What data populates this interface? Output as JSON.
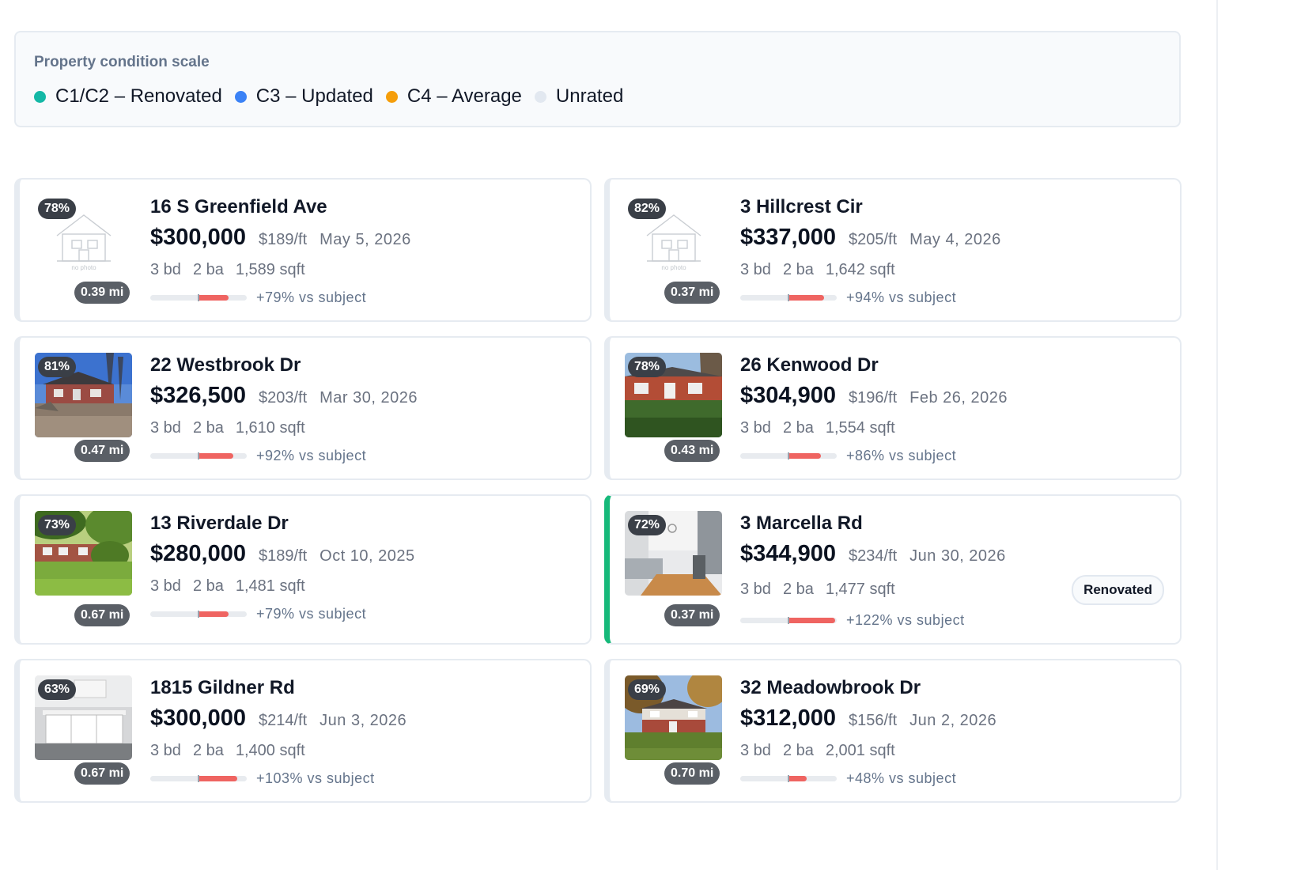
{
  "legend": {
    "title": "Property condition scale",
    "items": [
      {
        "label": "C1/C2 – Renovated",
        "color": "#14b8a6"
      },
      {
        "label": "C3 – Updated",
        "color": "#3b82f6"
      },
      {
        "label": "C4 – Average",
        "color": "#f59e0b"
      },
      {
        "label": "Unrated",
        "color": "#e2e8f0"
      }
    ]
  },
  "comps": [
    {
      "address": "16 S Greenfield Ave",
      "price": "$300,000",
      "ppsf": "$189/ft",
      "date": "May 5, 2026",
      "beds": "3 bd",
      "baths": "2 ba",
      "sqft": "1,589 sqft",
      "vs": "+79% vs subject",
      "vs_pct": 79,
      "score": "78%",
      "distance": "0.39 mi",
      "photo": "no-photo-icon",
      "no_photo_label": "no photo"
    },
    {
      "address": "3 Hillcrest Cir",
      "price": "$337,000",
      "ppsf": "$205/ft",
      "date": "May 4, 2026",
      "beds": "3 bd",
      "baths": "2 ba",
      "sqft": "1,642 sqft",
      "vs": "+94% vs subject",
      "vs_pct": 94,
      "score": "82%",
      "distance": "0.37 mi",
      "photo": "no-photo-icon",
      "no_photo_label": "no photo"
    },
    {
      "address": "22 Westbrook Dr",
      "price": "$326,500",
      "ppsf": "$203/ft",
      "date": "Mar 30, 2026",
      "beds": "3 bd",
      "baths": "2 ba",
      "sqft": "1,610 sqft",
      "vs": "+92% vs subject",
      "vs_pct": 92,
      "score": "81%",
      "distance": "0.47 mi",
      "photo": "house-exterior-winter"
    },
    {
      "address": "26 Kenwood Dr",
      "price": "$304,900",
      "ppsf": "$196/ft",
      "date": "Feb 26, 2026",
      "beds": "3 bd",
      "baths": "2 ba",
      "sqft": "1,554 sqft",
      "vs": "+86% vs subject",
      "vs_pct": 86,
      "score": "78%",
      "distance": "0.43 mi",
      "photo": "house-exterior-lawn"
    },
    {
      "address": "13 Riverdale Dr",
      "price": "$280,000",
      "ppsf": "$189/ft",
      "date": "Oct 10, 2025",
      "beds": "3 bd",
      "baths": "2 ba",
      "sqft": "1,481 sqft",
      "vs": "+79% vs subject",
      "vs_pct": 79,
      "score": "73%",
      "distance": "0.67 mi",
      "photo": "house-exterior-trees"
    },
    {
      "address": "3 Marcella Rd",
      "price": "$344,900",
      "ppsf": "$234/ft",
      "date": "Jun 30, 2026",
      "beds": "3 bd",
      "baths": "2 ba",
      "sqft": "1,477 sqft",
      "vs": "+122% vs subject",
      "vs_pct": 122,
      "score": "72%",
      "distance": "0.37 mi",
      "photo": "kitchen-interior",
      "badge": "Renovated",
      "condition_color": "#16b97a"
    },
    {
      "address": "1815 Gildner Rd",
      "price": "$300,000",
      "ppsf": "$214/ft",
      "date": "Jun 3, 2026",
      "beds": "3 bd",
      "baths": "2 ba",
      "sqft": "1,400 sqft",
      "vs": "+103% vs subject",
      "vs_pct": 103,
      "score": "63%",
      "distance": "0.67 mi",
      "photo": "kitchen-island-interior"
    },
    {
      "address": "32 Meadowbrook Dr",
      "price": "$312,000",
      "ppsf": "$156/ft",
      "date": "Jun 2, 2026",
      "beds": "3 bd",
      "baths": "2 ba",
      "sqft": "2,001 sqft",
      "vs": "+48% vs subject",
      "vs_pct": 48,
      "score": "69%",
      "distance": "0.70 mi",
      "photo": "house-exterior-autumn"
    }
  ]
}
